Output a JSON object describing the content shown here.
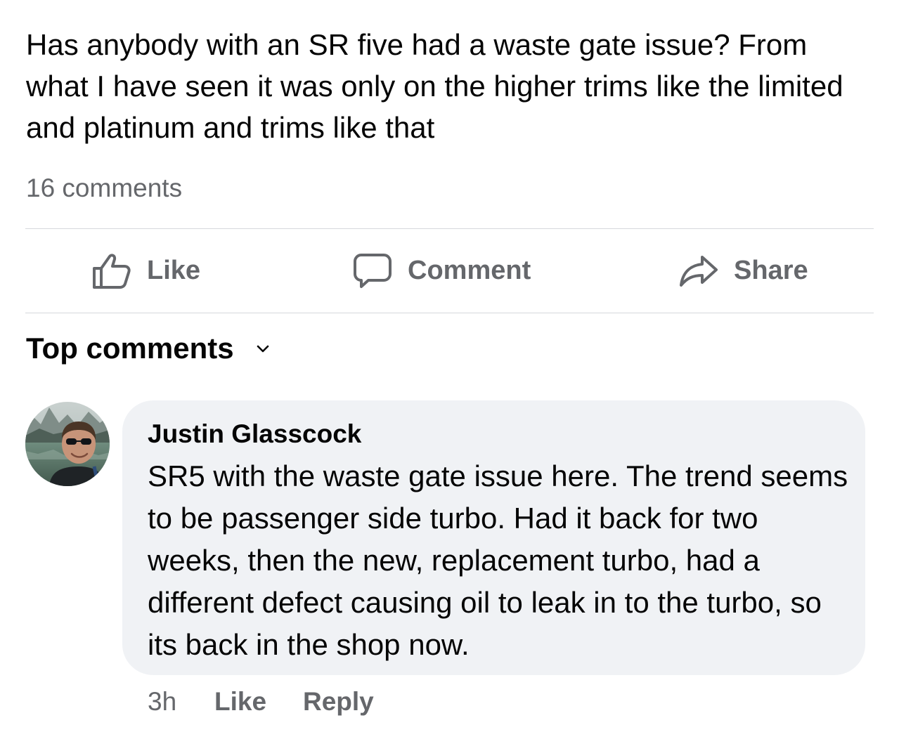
{
  "post": {
    "text": "Has anybody with an SR five had a waste gate issue? From what I have seen it was only on the higher trims like the limited and platinum and trims like that",
    "comment_count": "16 comments"
  },
  "actions": {
    "like": {
      "label": "Like",
      "icon": "thumbs-up-icon"
    },
    "comment": {
      "label": "Comment",
      "icon": "speech-bubble-icon"
    },
    "share": {
      "label": "Share",
      "icon": "share-arrow-icon"
    }
  },
  "comments_section": {
    "sort_label": "Top comments",
    "sort_icon": "chevron-down-icon"
  },
  "comments": [
    {
      "author": "Justin Glasscock",
      "avatar": "profile-photo",
      "text": "SR5 with the waste gate issue here. The trend seems to be passenger side turbo. Had it back for two weeks, then the new, replacement turbo, had a different defect causing oil to leak in to the turbo, so its back in the shop now.",
      "time": "3h",
      "like_label": "Like",
      "reply_label": "Reply"
    }
  ],
  "colors": {
    "text_primary": "#050505",
    "text_secondary": "#65676b",
    "bubble_background": "#f0f2f5",
    "divider": "#d6d8dc"
  }
}
